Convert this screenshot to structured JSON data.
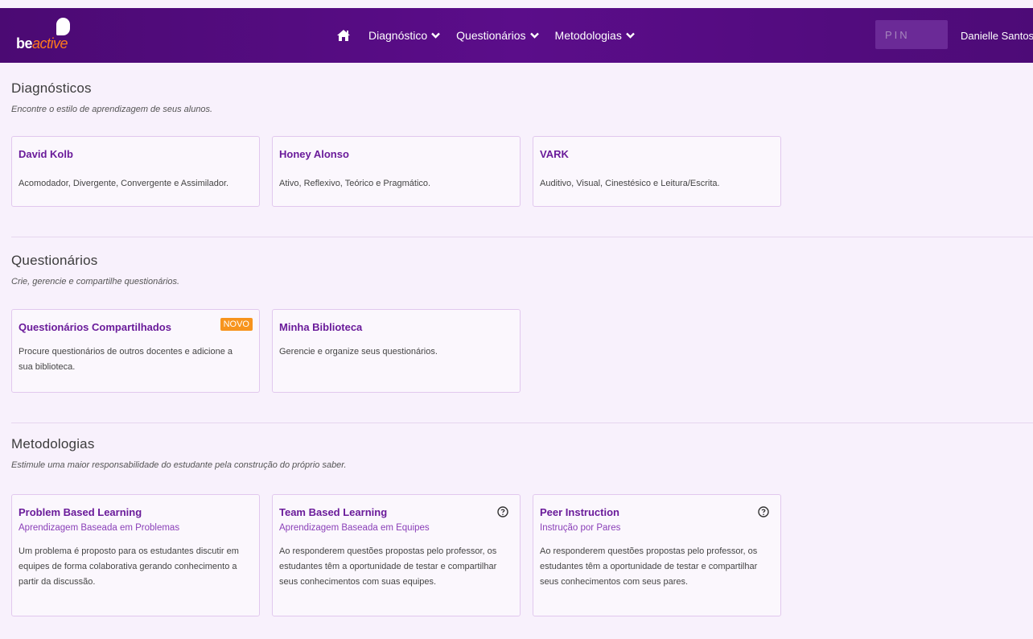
{
  "header": {
    "logo": {
      "be": "be",
      "active": "active"
    },
    "nav": [
      {
        "label": "Diagnóstico"
      },
      {
        "label": "Questionários"
      },
      {
        "label": "Metodologias"
      }
    ],
    "pin_placeholder": "PIN",
    "user_name": "Danielle Santos",
    "colors": {
      "bar": "#5b0d8a",
      "accent": "#ff7a1a"
    }
  },
  "diagnosticos": {
    "title": "Diagnósticos",
    "subtitle": "Encontre o estilo de aprendizagem de seus alunos.",
    "cards": [
      {
        "title": "David Kolb",
        "desc": "Acomodador, Divergente, Convergente e Assimilador."
      },
      {
        "title": "Honey Alonso",
        "desc": "Ativo, Reflexivo, Teórico e Pragmático."
      },
      {
        "title": "VARK",
        "desc": "Auditivo, Visual, Cinestésico e Leitura/Escrita."
      }
    ]
  },
  "questionarios": {
    "title": "Questionários",
    "subtitle": "Crie, gerencie e compartilhe questionários.",
    "cards": [
      {
        "title": "Questionários Compartilhados",
        "badge": "NOVO",
        "desc": "Procure questionários de outros docentes e adicione a sua biblioteca."
      },
      {
        "title": "Minha Biblioteca",
        "desc": "Gerencie e organize seus questionários."
      }
    ]
  },
  "metodologias": {
    "title": "Metodologias",
    "subtitle": "Estimule uma maior responsabilidade do estudante pela construção do próprio saber.",
    "cards": [
      {
        "title": "Problem Based Learning",
        "subtitle": "Aprendizagem Baseada em Problemas",
        "desc": "Um problema é proposto para os estudantes discutir em equipes de forma colaborativa gerando conhecimento a partir da discussão.",
        "icon": "help-circle-icon"
      },
      {
        "title": "Team Based Learning",
        "subtitle": "Aprendizagem Baseada em Equipes",
        "desc": "Ao responderem questões propostas pelo professor, os estudantes têm a oportunidade de testar e compartilhar seus conhecimentos com suas equipes.",
        "icon": "help-circle-icon"
      },
      {
        "title": "Peer Instruction",
        "subtitle": "Instrução por Pares",
        "desc": "Ao responderem questões propostas pelo professor, os estudantes têm a oportunidade de testar e compartilhar seus conhecimentos com seus pares.",
        "icon": "help-circle-icon"
      }
    ]
  }
}
